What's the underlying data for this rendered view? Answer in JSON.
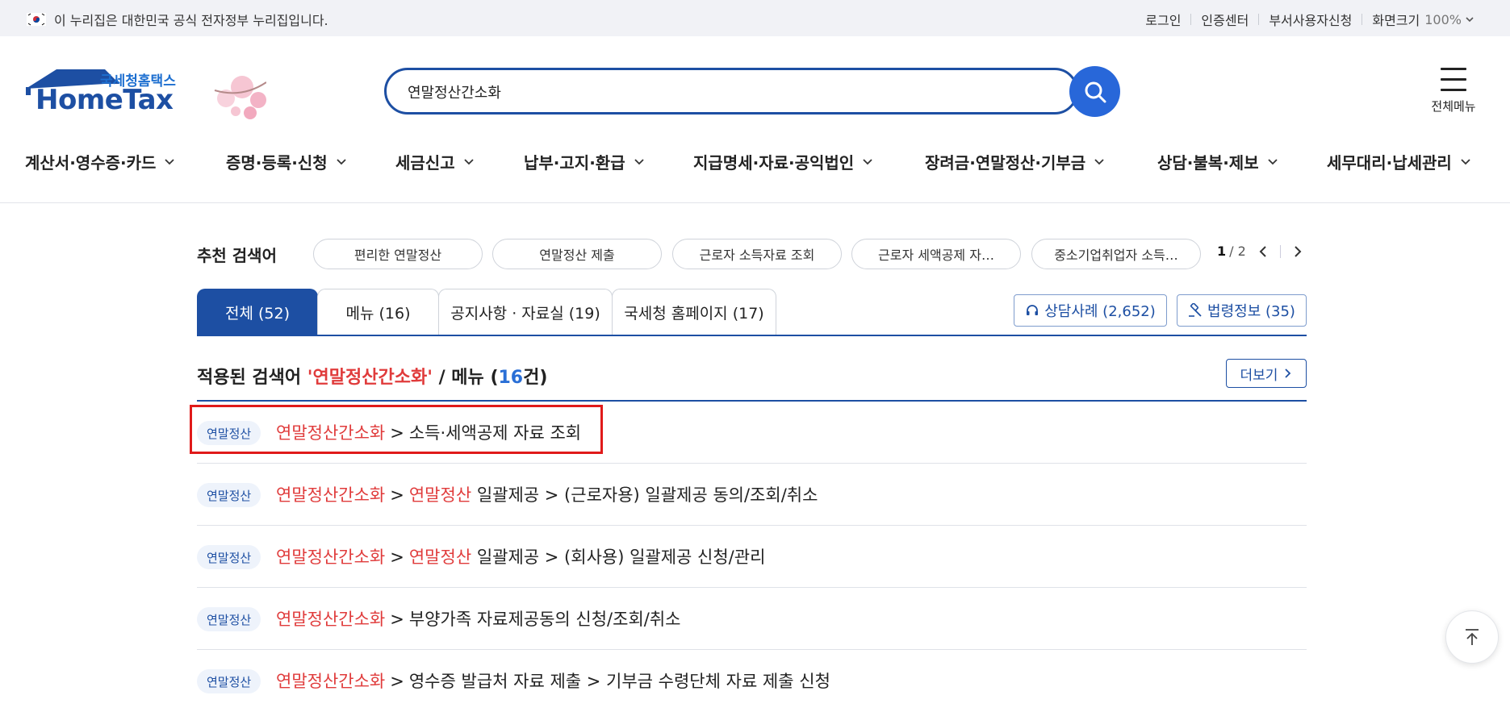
{
  "colors": {
    "brand_navy": "#1d4fa3",
    "search_blue": "#2867d9",
    "keyword_red": "#e03b3b",
    "count_blue": "#2a6fd6",
    "highlight_red": "#e01a1a",
    "topbar_bg": "#f1f2f6"
  },
  "gov_banner": {
    "text": "이 누리집은 대한민국 공식 전자정부 누리집입니다."
  },
  "utility": {
    "login": "로그인",
    "cert_center": "인증센터",
    "dept_user": "부서사용자신청",
    "zoom_label": "화면크기",
    "zoom_value": "100%"
  },
  "logo": {
    "subtitle": "국세청홈택스",
    "title": "HomeTax"
  },
  "search": {
    "value": "연말정산간소화"
  },
  "all_menu": {
    "label": "전체메뉴"
  },
  "gnb": [
    "계산서·영수증·카드",
    "증명·등록·신청",
    "세금신고",
    "납부·고지·환급",
    "지급명세·자료·공익법인",
    "장려금·연말정산·기부금",
    "상담·불복·제보",
    "세무대리·납세관리"
  ],
  "recommend": {
    "label": "추천 검색어",
    "chips": [
      "편리한 연말정산",
      "연말정산 제출",
      "근로자 소득자료 조회",
      "근로자 세액공제 자…",
      "중소기업취업자 소득…"
    ],
    "page_current": "1",
    "page_total": "/ 2"
  },
  "tabs": [
    {
      "label": "전체 (52)"
    },
    {
      "label": "메뉴 (16)"
    },
    {
      "label": "공지사항 · 자료실 (19)"
    },
    {
      "label": "국세청 홈페이지 (17)"
    }
  ],
  "side_buttons": {
    "consult": "상담사례 (2,652)",
    "law": "법령정보 (35)"
  },
  "section": {
    "prefix": "적용된 검색어",
    "keyword": "'연말정산간소화'",
    "slash": "/ 메뉴 (",
    "count": "16",
    "suffix": "건)",
    "more": "더보기"
  },
  "results": [
    {
      "badge": "연말정산",
      "kw": "연말정산간소화",
      "gt1": ">",
      "kw2": "",
      "rest": "소득·세액공제 자료 조회"
    },
    {
      "badge": "연말정산",
      "kw": "연말정산간소화",
      "gt1": ">",
      "kw2": "연말정산",
      "rest": "일괄제공 > (근로자용) 일괄제공 동의/조회/취소"
    },
    {
      "badge": "연말정산",
      "kw": "연말정산간소화",
      "gt1": ">",
      "kw2": "연말정산",
      "rest": "일괄제공 > (회사용) 일괄제공 신청/관리"
    },
    {
      "badge": "연말정산",
      "kw": "연말정산간소화",
      "gt1": ">",
      "kw2": "",
      "rest": "부양가족 자료제공동의 신청/조회/취소"
    },
    {
      "badge": "연말정산",
      "kw": "연말정산간소화",
      "gt1": ">",
      "kw2": "",
      "rest": "영수증 발급처 자료 제출 > 기부금 수령단체 자료 제출 신청"
    }
  ]
}
